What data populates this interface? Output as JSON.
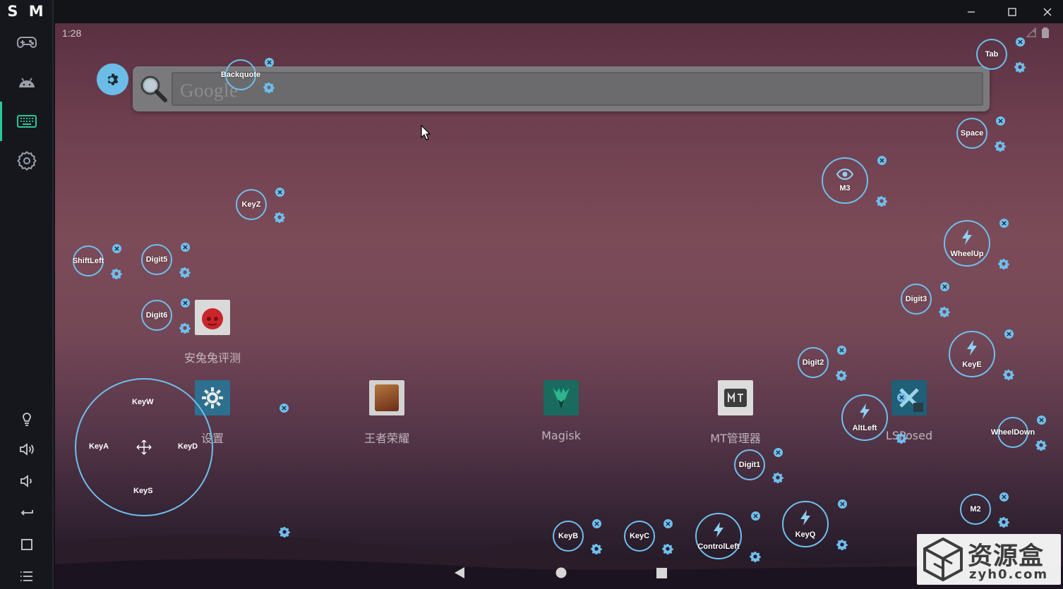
{
  "sidebar": {
    "brand": "S M",
    "accent": "#29c799",
    "top_items": [
      {
        "icon": "gamepad-icon"
      },
      {
        "icon": "android-icon"
      },
      {
        "icon": "keyboard-icon",
        "active": true
      },
      {
        "icon": "settings-gear-icon"
      }
    ],
    "bottom_items": [
      {
        "icon": "lightbulb-icon"
      },
      {
        "icon": "volume-up-icon"
      },
      {
        "icon": "volume-down-icon"
      },
      {
        "icon": "back-arrow-icon"
      },
      {
        "icon": "square-icon"
      },
      {
        "icon": "menu-list-icon"
      }
    ]
  },
  "titlebar": {
    "controls": [
      "minimize-icon",
      "maximize-icon",
      "close-icon"
    ]
  },
  "android": {
    "time": "1:28",
    "search_placeholder": "Google",
    "apps": [
      {
        "name": "安兔兔评测"
      },
      {
        "name": "设置"
      },
      {
        "name": "王者荣耀"
      },
      {
        "name": "Magisk"
      },
      {
        "name": "MT管理器"
      },
      {
        "name": "LSPosed"
      }
    ],
    "nav": [
      "back-triangle-icon",
      "home-circle-icon",
      "recents-square-icon"
    ]
  },
  "keymap": {
    "color": "#6fbfee",
    "buttons": {
      "backquote": "Backquote",
      "tab": "Tab",
      "space": "Space",
      "m3": "M3",
      "keyz": "KeyZ",
      "wheelup": "WheelUp",
      "shiftleft": "ShiftLeft",
      "digit5": "Digit5",
      "digit3": "Digit3",
      "digit6": "Digit6",
      "keye": "KeyE",
      "digit2": "Digit2",
      "altleft": "AltLeft",
      "wheeldown": "WheelDown",
      "digit1": "Digit1",
      "m2": "M2",
      "keyb": "KeyB",
      "keyc": "KeyC",
      "controlleft": "ControlLeft",
      "keyq": "KeyQ"
    },
    "dpad": {
      "up": "KeyW",
      "left": "KeyA",
      "right": "KeyD",
      "down": "KeyS"
    }
  },
  "watermark": {
    "title": "资源盒",
    "url": "zyh0.com"
  }
}
